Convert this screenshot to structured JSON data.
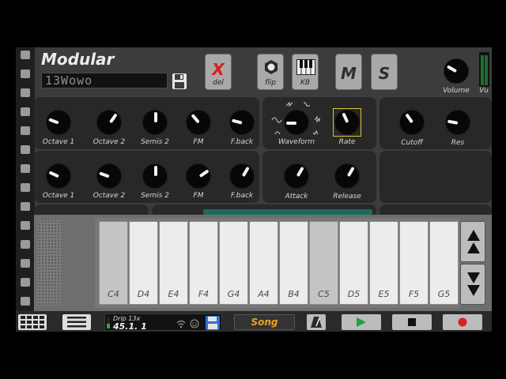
{
  "header": {
    "title": "Modular",
    "patch_name": "13Wowo",
    "del_symbol": "X",
    "del_label": "del",
    "flip_label": "flip",
    "kb_label": "KB",
    "m_label": "M",
    "s_label": "S",
    "volume_label": "Volume",
    "vu_label": "Vu"
  },
  "row1": {
    "knobs": [
      "Octave 1",
      "Octave 2",
      "Semis 2",
      "FM",
      "F.back"
    ],
    "lfo_waveform": "Waveform",
    "lfo_rate": "Rate",
    "cutoff": "Cutoff",
    "res": "Res"
  },
  "row2": {
    "knobs": [
      "Octave 1",
      "Octave 2",
      "Semis 2",
      "FM",
      "F.back"
    ],
    "attack": "Attack",
    "release": "Release"
  },
  "keyboard": {
    "keys": [
      "C4",
      "D4",
      "E4",
      "F4",
      "G4",
      "A4",
      "B4",
      "C5",
      "D5",
      "E5",
      "F5",
      "G5"
    ]
  },
  "bottom": {
    "track_name": "Drip 13x",
    "position": "45.1. 1",
    "song_label": "Song"
  },
  "colors": {
    "accent_orange": "#f0a020",
    "del_red": "#e01818",
    "play_green": "#1fa33a",
    "record_red": "#dd1f1f",
    "scroll_teal": "#1e6a5c",
    "rate_highlight": "#d8c838"
  }
}
